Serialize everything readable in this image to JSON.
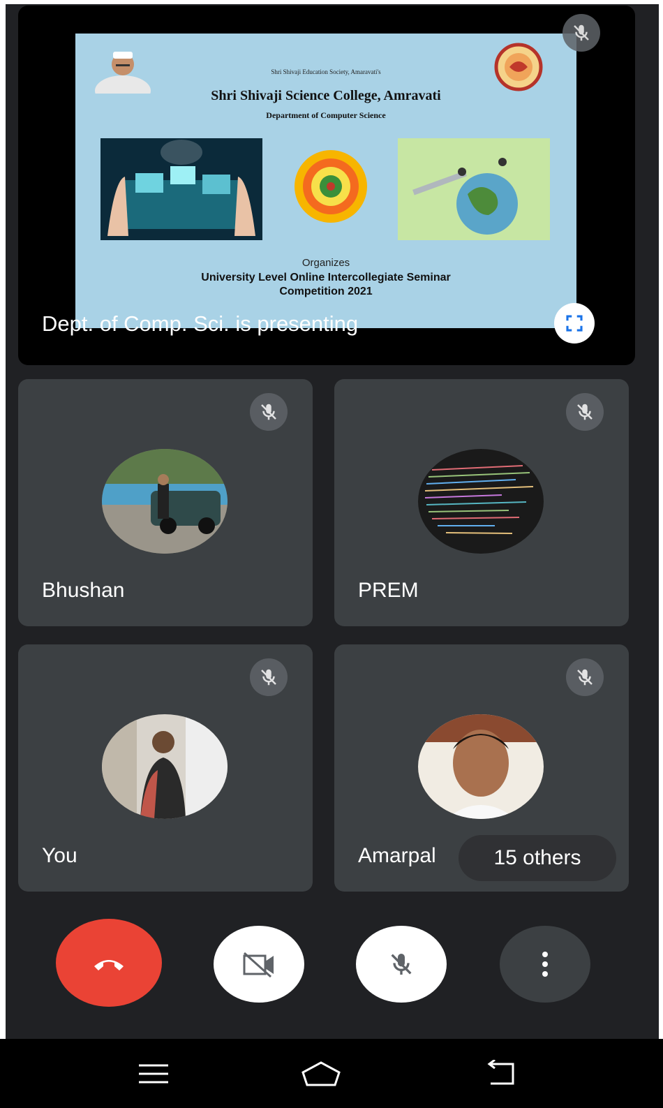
{
  "presentation": {
    "label": "Dept. of Comp. Sci. is presenting",
    "slide": {
      "society": "Shri Shivaji Education Society, Amaravati's",
      "college": "Shri Shivaji Science College, Amravati",
      "department": "Department of Computer Science",
      "organizes": "Organizes",
      "event_line1": "University Level Online Intercollegiate Seminar",
      "event_line2": "Competition 2021"
    }
  },
  "participants": [
    {
      "name": "Bhushan",
      "mic": "muted"
    },
    {
      "name": "PREM",
      "mic": "muted"
    },
    {
      "name": "You",
      "mic": "muted"
    },
    {
      "name": "Amarpal",
      "mic": "muted"
    }
  ],
  "others": {
    "label": "15 others"
  },
  "controls": {
    "end_call": "end-call",
    "camera": "camera-off",
    "microphone": "mic-off",
    "more": "more-options"
  },
  "colors": {
    "background": "#202124",
    "tile": "#3c4043",
    "end_call": "#ea4335",
    "fullscreen_accent": "#1a73e8"
  }
}
